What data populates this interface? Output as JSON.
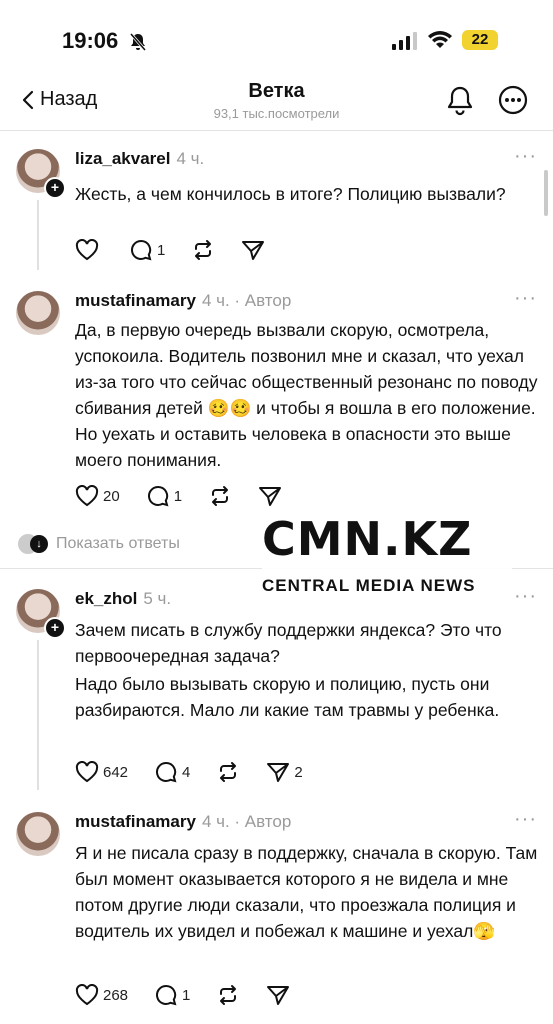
{
  "status": {
    "time": "19:06",
    "battery": "22"
  },
  "nav": {
    "back": "Назад",
    "title": "Ветка",
    "subtitle": "93,1 тыс.посмотрели"
  },
  "posts": [
    {
      "user": "liza_akvarel",
      "meta": "4 ч.",
      "text": "Жесть, а чем кончилось в итоге? Полицию вызвали?",
      "likes": "",
      "replies": "1",
      "shares": ""
    },
    {
      "user": "mustafinamary",
      "meta": "4 ч. · Автор",
      "text": "Да, в первую очередь вызвали скорую, осмотрела, успокоила. Водитель позвонил мне и сказал, что уехал из-за того что сейчас общественный резонанс по поводу сбивания детей 🥴🥴 и чтобы я вошла в его положение. Но уехать и оставить человека в опасности это выше моего понимания.",
      "likes": "20",
      "replies": "1",
      "shares": ""
    },
    {
      "user": "ek_zhol",
      "meta": "5 ч.",
      "text": "Зачем писать в службу поддержки яндекса? Это что первоочередная задача?",
      "text2": "Надо было вызывать скорую и полицию, пусть они разбираются. Мало ли какие там травмы у ребенка.",
      "likes": "642",
      "replies": "4",
      "shares": "2"
    },
    {
      "user": "mustafinamary",
      "meta": "4 ч. · Автор",
      "text": "Я и не писала сразу в поддержку, сначала в скорую. Там был момент оказывается которого я не видела и мне потом другие люди сказали, что проезжала полиция и водитель их увидел и побежал к машине и уехал🫣",
      "likes": "268",
      "replies": "1",
      "shares": ""
    }
  ],
  "show_replies": "Показать ответы",
  "watermark": {
    "logo": "CMN.KZ",
    "sub": "CENTRAL MEDIA NEWS"
  }
}
